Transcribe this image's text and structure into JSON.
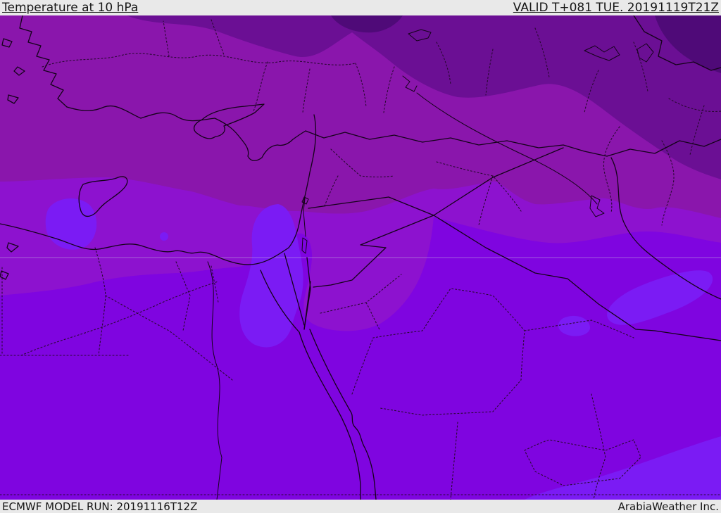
{
  "header": {
    "title": "Temperature at 10 hPa",
    "valid_label": "VALID T+081 TUE. 20191119T21Z"
  },
  "footer": {
    "model_run_label": "ECMWF MODEL RUN: 20191116T12Z",
    "credit_label": "ArabiaWeather Inc."
  },
  "map": {
    "palette": {
      "zone_darkest": "#4f0a78",
      "zone_dark": "#6b0f94",
      "zone_purple": "#8a16ac",
      "zone_violet": "#8d12cf",
      "zone_bright_violet": "#7f05e0",
      "zone_brightest_patch": "#7b1bf4"
    },
    "lines": {
      "boundary": "#15021a",
      "admin": "#2a0833",
      "gridline": "#c3b0e0"
    }
  },
  "chrome": {
    "bar_background": "#e9e9e9",
    "bar_text": "#161616"
  }
}
